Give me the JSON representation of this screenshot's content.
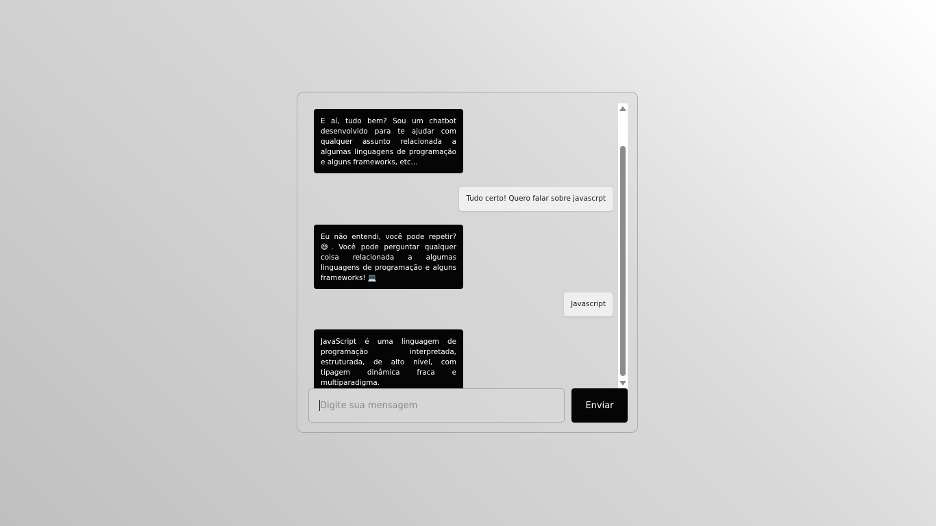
{
  "chat": {
    "messages": [
      {
        "sender": "bot",
        "text": "E aí, tudo bem? Sou um chatbot desenvolvido para te ajudar com qualquer assunto relacionada a algumas linguagens de programação e alguns frameworks, etc..."
      },
      {
        "sender": "user",
        "text": "Tudo certo! Quero falar sobre javascrpt"
      },
      {
        "sender": "bot",
        "text": "Eu não entendi, você pode repetir? 😅. Você pode perguntar qualquer coisa relacionada a algumas linguagens de programação e alguns frameworks! 💻"
      },
      {
        "sender": "user",
        "text": "Javascript"
      },
      {
        "sender": "bot",
        "text": "JavaScript é uma linguagem de programação interpretada, estruturada, de alto nível, com tipagem dinâmica fraca e multiparadigma."
      }
    ]
  },
  "input": {
    "placeholder": "Digite sua mensagem",
    "value": ""
  },
  "send_button": {
    "label": "Enviar"
  },
  "colors": {
    "bot_bubble": "#050505",
    "user_bubble": "#efefef",
    "button": "#050505"
  }
}
